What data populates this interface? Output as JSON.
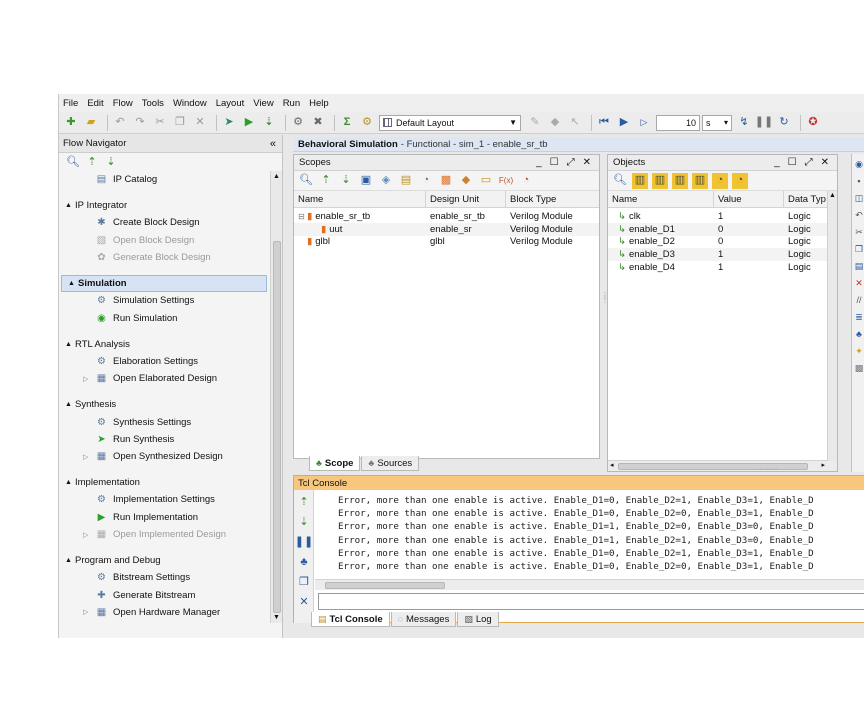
{
  "menu": [
    "File",
    "Edit",
    "Flow",
    "Tools",
    "Window",
    "Layout",
    "View",
    "Run",
    "Help"
  ],
  "toolbar": {
    "layout_label": "Default Layout",
    "run_time_value": "10",
    "run_time_unit": "s"
  },
  "flow_navigator": {
    "title": "Flow Navigator",
    "collapse_glyph": "«",
    "sections": [
      {
        "label": "IP Catalog",
        "kind": "item",
        "icon": "ip-catalog-icon",
        "glyph": "▤"
      },
      {
        "label": "IP Integrator",
        "kind": "section"
      },
      {
        "label": "Create Block Design",
        "kind": "item",
        "icon": "create-block-design-icon",
        "glyph": "✱"
      },
      {
        "label": "Open Block Design",
        "kind": "item",
        "disabled": true,
        "icon": "open-block-design-icon",
        "glyph": "▧"
      },
      {
        "label": "Generate Block Design",
        "kind": "item",
        "disabled": true,
        "icon": "generate-block-design-icon",
        "glyph": "✿"
      },
      {
        "label": "Simulation",
        "kind": "section",
        "selected": true
      },
      {
        "label": "Simulation Settings",
        "kind": "item",
        "icon": "settings-gear-icon",
        "glyph": "⚙"
      },
      {
        "label": "Run Simulation",
        "kind": "item",
        "icon": "run-simulation-icon",
        "glyph": "◉"
      },
      {
        "label": "RTL Analysis",
        "kind": "section"
      },
      {
        "label": "Elaboration Settings",
        "kind": "item",
        "icon": "settings-gear-icon",
        "glyph": "⚙"
      },
      {
        "label": "Open Elaborated Design",
        "kind": "item",
        "expander": true,
        "icon": "open-design-icon",
        "glyph": "▦"
      },
      {
        "label": "Synthesis",
        "kind": "section"
      },
      {
        "label": "Synthesis Settings",
        "kind": "item",
        "icon": "settings-gear-icon",
        "glyph": "⚙"
      },
      {
        "label": "Run Synthesis",
        "kind": "item",
        "icon": "run-synthesis-icon",
        "glyph": "➤"
      },
      {
        "label": "Open Synthesized Design",
        "kind": "item",
        "expander": true,
        "icon": "open-design-icon",
        "glyph": "▦"
      },
      {
        "label": "Implementation",
        "kind": "section"
      },
      {
        "label": "Implementation Settings",
        "kind": "item",
        "icon": "settings-gear-icon",
        "glyph": "⚙"
      },
      {
        "label": "Run Implementation",
        "kind": "item",
        "icon": "run-implementation-icon",
        "glyph": "▶"
      },
      {
        "label": "Open Implemented Design",
        "kind": "item",
        "expander": true,
        "disabled": true,
        "icon": "open-design-icon",
        "glyph": "▦"
      },
      {
        "label": "Program and Debug",
        "kind": "section"
      },
      {
        "label": "Bitstream Settings",
        "kind": "item",
        "icon": "settings-gear-icon",
        "glyph": "⚙"
      },
      {
        "label": "Generate Bitstream",
        "kind": "item",
        "icon": "generate-bitstream-icon",
        "glyph": "✚"
      },
      {
        "label": "Open Hardware Manager",
        "kind": "item",
        "expander": true,
        "icon": "hardware-manager-icon",
        "glyph": "▦"
      }
    ]
  },
  "sim_header": {
    "title": "Behavioral Simulation",
    "subtitle": "- Functional - sim_1 - enable_sr_tb"
  },
  "scopes": {
    "title": "Scopes",
    "columns": [
      "Name",
      "Design Unit",
      "Block Type"
    ],
    "rows": [
      {
        "name": "enable_sr_tb",
        "unit": "enable_sr_tb",
        "type": "Verilog Module",
        "indent": 0,
        "expander": "⊟"
      },
      {
        "name": "uut",
        "unit": "enable_sr",
        "type": "Verilog Module",
        "indent": 1,
        "expander": ""
      },
      {
        "name": "glbl",
        "unit": "glbl",
        "type": "Verilog Module",
        "indent": 0,
        "expander": ""
      }
    ],
    "tabs": [
      {
        "label": "Scope",
        "active": true
      },
      {
        "label": "Sources",
        "active": false
      }
    ]
  },
  "objects": {
    "title": "Objects",
    "columns": [
      "Name",
      "Value",
      "Data Typ"
    ],
    "rows": [
      {
        "name": "clk",
        "value": "1",
        "type": "Logic"
      },
      {
        "name": "enable_D1",
        "value": "0",
        "type": "Logic"
      },
      {
        "name": "enable_D2",
        "value": "0",
        "type": "Logic"
      },
      {
        "name": "enable_D3",
        "value": "1",
        "type": "Logic"
      },
      {
        "name": "enable_D4",
        "value": "1",
        "type": "Logic"
      }
    ]
  },
  "console": {
    "title": "Tcl Console",
    "lines": [
      "Error, more than one enable is active. Enable_D1=0, Enable_D2=1, Enable_D3=1, Enable_D",
      "Error, more than one enable is active. Enable_D1=0, Enable_D2=0, Enable_D3=1, Enable_D",
      "Error, more than one enable is active. Enable_D1=1, Enable_D2=0, Enable_D3=0, Enable_D",
      "Error, more than one enable is active. Enable_D1=1, Enable_D2=1, Enable_D3=0, Enable_D",
      "Error, more than one enable is active. Enable_D1=0, Enable_D2=1, Enable_D3=1, Enable_D",
      "Error, more than one enable is active. Enable_D1=0, Enable_D2=0, Enable_D3=1, Enable_D"
    ],
    "tabs": [
      {
        "label": "Tcl Console",
        "active": true
      },
      {
        "label": "Messages",
        "active": false
      },
      {
        "label": "Log",
        "active": false
      }
    ]
  },
  "colors": {
    "accent": "#dde6f2",
    "console_header": "#f7c77e",
    "selected_section": "#d6e3f5",
    "run_green": "#2aa02a"
  }
}
